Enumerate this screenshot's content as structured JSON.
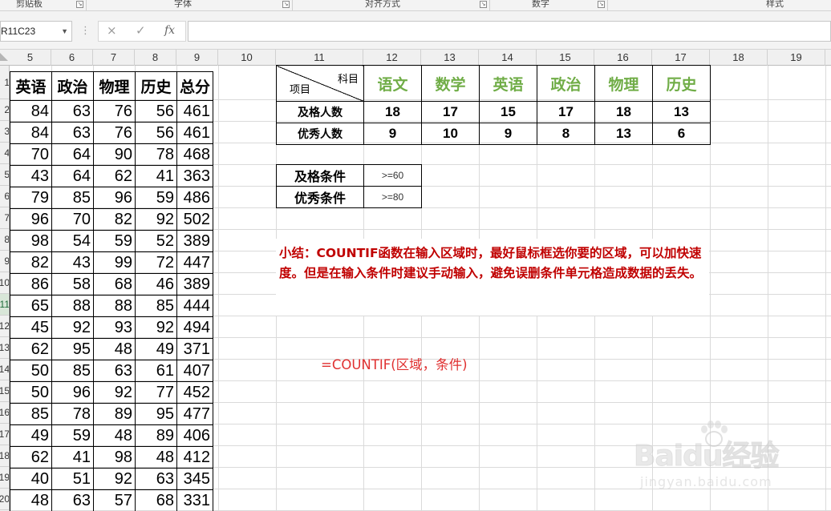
{
  "ribbon": {
    "groups": [
      "剪贴板",
      "字体",
      "对齐方式",
      "数字",
      "样式"
    ]
  },
  "formula_bar": {
    "name_box": "R11C23",
    "cancel_icon": "×",
    "enter_icon": "✓",
    "fx_icon": "fx",
    "formula": ""
  },
  "columns": [
    "5",
    "6",
    "7",
    "8",
    "9",
    "10",
    "11",
    "12",
    "13",
    "14",
    "15",
    "16",
    "17",
    "18",
    "19"
  ],
  "row_numbers": [
    "1",
    "2",
    "3",
    "4",
    "5",
    "6",
    "7",
    "8",
    "9",
    "10",
    "11",
    "12",
    "13",
    "14",
    "15",
    "16",
    "17",
    "18",
    "19",
    "20"
  ],
  "active_row": "11",
  "score_table": {
    "headers": [
      "英语",
      "政治",
      "物理",
      "历史",
      "总分"
    ],
    "rows": [
      [
        "84",
        "63",
        "76",
        "56",
        "461"
      ],
      [
        "84",
        "63",
        "76",
        "56",
        "461"
      ],
      [
        "70",
        "64",
        "90",
        "78",
        "468"
      ],
      [
        "43",
        "64",
        "62",
        "41",
        "363"
      ],
      [
        "79",
        "85",
        "96",
        "59",
        "486"
      ],
      [
        "96",
        "70",
        "82",
        "92",
        "502"
      ],
      [
        "98",
        "54",
        "59",
        "52",
        "389"
      ],
      [
        "82",
        "43",
        "99",
        "72",
        "447"
      ],
      [
        "86",
        "58",
        "68",
        "46",
        "389"
      ],
      [
        "65",
        "88",
        "88",
        "85",
        "444"
      ],
      [
        "45",
        "92",
        "93",
        "92",
        "494"
      ],
      [
        "62",
        "95",
        "48",
        "49",
        "371"
      ],
      [
        "50",
        "85",
        "63",
        "61",
        "407"
      ],
      [
        "50",
        "96",
        "92",
        "77",
        "452"
      ],
      [
        "85",
        "78",
        "89",
        "95",
        "477"
      ],
      [
        "49",
        "59",
        "48",
        "89",
        "406"
      ],
      [
        "62",
        "41",
        "98",
        "48",
        "412"
      ],
      [
        "40",
        "51",
        "92",
        "63",
        "345"
      ],
      [
        "48",
        "63",
        "57",
        "68",
        "331"
      ]
    ]
  },
  "stats_table": {
    "corner_top": "科目",
    "corner_bottom": "项目",
    "subjects": [
      "语文",
      "数学",
      "英语",
      "政治",
      "物理",
      "历史"
    ],
    "subject_color": "#70ad47",
    "pass_label": "及格人数",
    "pass_counts": [
      "18",
      "17",
      "15",
      "17",
      "18",
      "13"
    ],
    "excellent_label": "优秀人数",
    "excellent_counts": [
      "9",
      "10",
      "9",
      "8",
      "13",
      "6"
    ]
  },
  "conditions": {
    "pass_label": "及格条件",
    "pass_value": ">=60",
    "excellent_label": "优秀条件",
    "excellent_value": ">=80"
  },
  "note": {
    "text": "小结：COUNTIF函数在输入区域时，最好鼠标框选你要的区域，可以加快速度。但是在输入条件时建议手动输入，避免误删条件单元格造成数据的丢失。",
    "color": "#c00000"
  },
  "formula_hint": {
    "text": "=COUNTIF(区域，条件)",
    "color": "#e03030"
  },
  "watermark": {
    "brand": "Baidu经验",
    "url": "jingyan.baidu.com"
  }
}
